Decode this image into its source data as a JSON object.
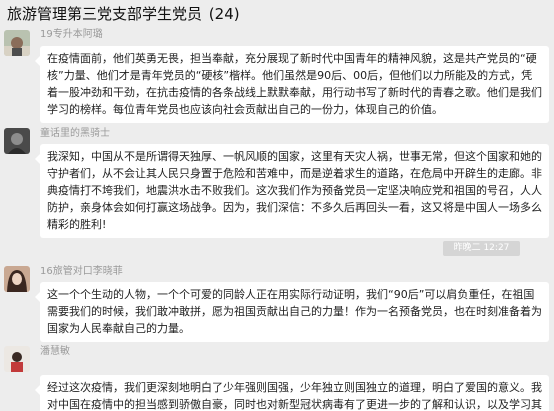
{
  "header": {
    "title": "旅游管理第三党支部学生党员",
    "count": "(24)"
  },
  "messages": [
    {
      "sender": "19专升本阿璐",
      "text": "在疫情面前，他们英勇无畏，担当奉献，充分展现了新时代中国青年的精神风貌，这是共产党员的“硬核”力量、他们才是青年党员的“硬核”楷样。他们虽然是90后、00后，但他们以力所能及的方式，凭着一股冲劲和干劲，在抗击疫情的各条战线上默默奉献，用行动书写了新时代的青春之歌。他们是我们学习的榜样。每位青年党员也应该向社会贡献出自己的一份力，体现自己的价值。",
      "avatar_colors": [
        "#b9c2b0",
        "#8a6d5a"
      ]
    },
    {
      "sender": "童话里的黑骑士",
      "text": "我深知，中国从不是所谓得天独厚、一帆风顺的国家，这里有天灾人祸，世事无常，但这个国家和她的守护者们，从不会让其人民只身置于危险和苦难中，而是逆着求生的道路，在危局中开辟生的走廊。非典疫情打不垮我们，地震洪水击不败我们。这次我们作为预备党员一定坚决响应党和祖国的号召，人人防护，亲身体会如何打赢这场战争。因为，我们深信：不多久后再回头一看，这又将是中国人一场多么精彩的胜利!",
      "avatar_colors": [
        "#3a3a3a",
        "#6b6b6b"
      ]
    },
    {
      "time": "昨晚二 12:27"
    },
    {
      "sender": "16旅管对口李晓菲",
      "text": "这一个个生动的人物，一个个可爱的同龄人正在用实际行动证明，我们“90后”可以肩负重任，在祖国需要我们的时候，我们敢冲敢拼，愿为祖国贡献出自己的力量！作为一名预备党员，也在时刻准备着为国家为人民奉献自己的力量。",
      "avatar_colors": [
        "#5a3b2e",
        "#c9a892"
      ]
    },
    {
      "sender": "潘慧敏",
      "text": "经过这次疫情，我们更深刻地明白了少年强则国强，少年独立则国独立的道理，明白了爱国的意义。我对中国在疫情中的担当感到骄傲自豪，同时也对新型冠状病毒有了更进一步的了解和认识，以及学习其",
      "avatar_colors": [
        "#e8e2dc",
        "#c23a3a"
      ]
    }
  ]
}
